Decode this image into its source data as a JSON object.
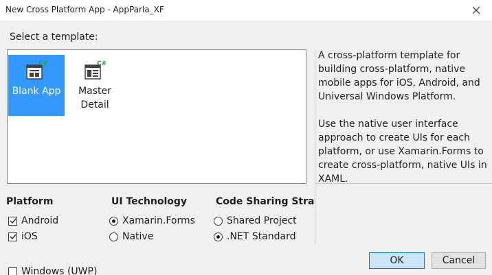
{
  "window": {
    "title": "New Cross Platform App - AppParla_XF"
  },
  "select_template_label": "Select a template:",
  "templates": [
    {
      "label_line1": "Blank App",
      "label_line2": "",
      "selected": true
    },
    {
      "label_line1": "Master",
      "label_line2": "Detail",
      "selected": false
    }
  ],
  "description": {
    "paragraph1": "A cross-platform template for building cross-platform, native mobile apps for iOS, Android, and Universal Windows Platform.",
    "paragraph2": "Use the native user interface approach to create UIs for each platform, or use Xamarin.Forms to create cross-platform, native UIs in XAML."
  },
  "platform": {
    "title": "Platform",
    "options": [
      {
        "label": "Android",
        "checked": true
      },
      {
        "label": "iOS",
        "checked": true
      },
      {
        "label": "Windows (UWP)",
        "checked": false
      }
    ]
  },
  "ui_technology": {
    "title": "UI Technology",
    "options": [
      {
        "label": "Xamarin.Forms",
        "selected": true
      },
      {
        "label": "Native",
        "selected": false
      }
    ]
  },
  "code_sharing": {
    "title": "Code Sharing Strategy",
    "options": [
      {
        "label": "Shared Project",
        "selected": false
      },
      {
        "label": ".NET Standard",
        "selected": true
      }
    ]
  },
  "buttons": {
    "ok": "OK",
    "cancel": "Cancel"
  },
  "colors": {
    "selection": "#3399ff",
    "ok_button_bg": "#cce4f7",
    "ok_button_border": "#0078d7",
    "csharp_badge": "#2e9e3e"
  }
}
